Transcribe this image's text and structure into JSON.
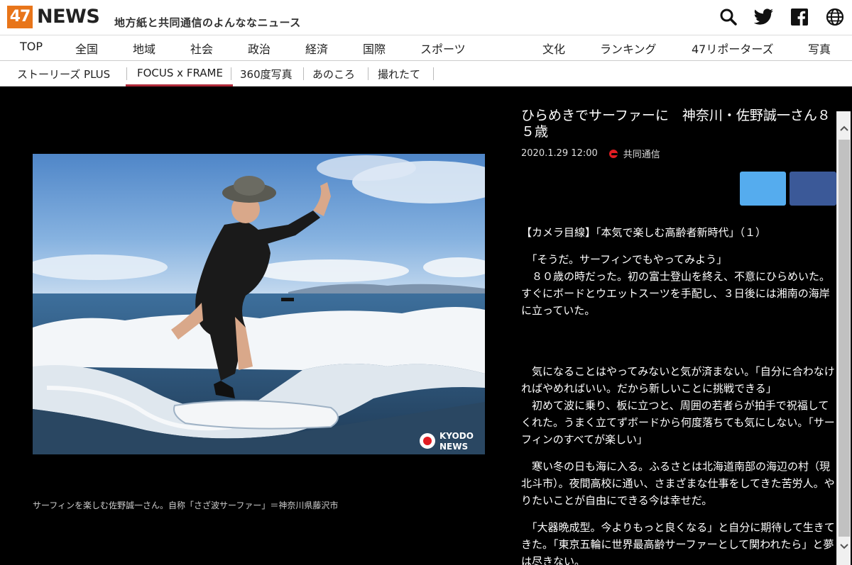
{
  "header": {
    "logo_num": "47",
    "logo_text": "NEWS",
    "tagline": "地方紙と共同通信のよんななニュース",
    "icons": [
      "search-icon",
      "twitter-icon",
      "facebook-icon",
      "globe-icon"
    ]
  },
  "main_nav": [
    "TOP",
    "全国",
    "地域",
    "社会",
    "政治",
    "経済",
    "国際",
    "スポーツ",
    "文化",
    "ランキング",
    "47リポーターズ",
    "写真"
  ],
  "sub_nav": [
    "ストーリーズ PLUS",
    "FOCUS x FRAME",
    "360度写真",
    "あのころ",
    "撮れたて"
  ],
  "photo": {
    "watermark_line1": "KYODO",
    "watermark_line2": "NEWS",
    "caption": "サーフィンを楽しむ佐野誠一さん。自称「さざ波サーファー」＝神奈川県藤沢市"
  },
  "article": {
    "title": "ひらめきでサーファーに　神奈川・佐野誠一さん８５歳",
    "date": "2020.1.29 12:00",
    "source": "共同通信",
    "lead": "【カメラ目線】「本気で楽しむ高齢者新時代」（１）",
    "paragraphs": [
      "　「そうだ。サーフィンでもやってみよう」\n　８０歳の時だった。初の富士登山を終え、不意にひらめいた。すぐにボードとウエットスーツを手配し、３日後には湘南の海岸に立っていた。",
      "",
      "　気になることはやってみないと気が済まない。「自分に合わなければやめればいい。だから新しいことに挑戦できる」\n　初めて波に乗り、板に立つと、周囲の若者らが拍手で祝福してくれた。うまく立てずボードから何度落ちても気にしない。「サーフィンのすべてが楽しい」",
      "　寒い冬の日も海に入る。ふるさとは北海道南部の海辺の村（現北斗市）。夜間高校に通い、さまざまな仕事をしてきた苦労人。やりたいことが自由にできる今は幸せだ。",
      "　「大器晩成型。今よりもっと良くなる」と自分に期待して生きてきた。「東京五輪に世界最高齢サーファーとして関われたら」と夢は尽きない。"
    ]
  },
  "colors": {
    "logo_orange": "#e8751a",
    "active_underline": "#b02a3a",
    "twitter_blue": "#55acee",
    "facebook_blue": "#3b5998"
  }
}
